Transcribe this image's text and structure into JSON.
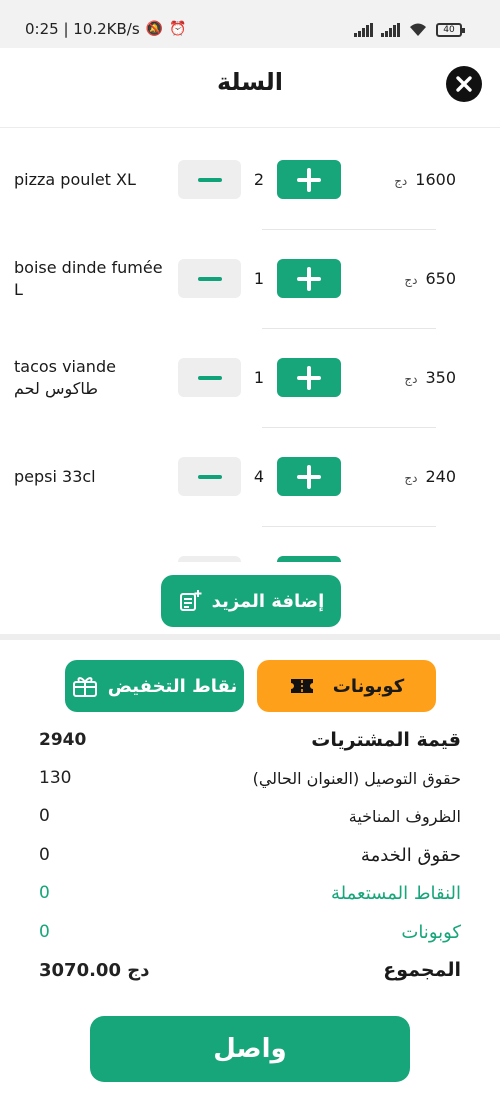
{
  "status_bar": {
    "time_speed": "0:25 | 10.2KB/s",
    "battery": "40"
  },
  "header": {
    "title": "السلة"
  },
  "cart": {
    "items": [
      {
        "name": "pizza poulet XL",
        "qty": "2",
        "price": "1600",
        "currency": "دج"
      },
      {
        "name": "boise dinde fumée L",
        "qty": "1",
        "price": "650",
        "currency": "دج"
      },
      {
        "name": "tacos viande طاكوس لحم",
        "qty": "1",
        "price": "350",
        "currency": "دج"
      },
      {
        "name": "pepsi 33cl",
        "qty": "4",
        "price": "240",
        "currency": "دج"
      }
    ],
    "add_more_label": "إضافة المزيد"
  },
  "discounts": {
    "coupons_label": "كوبونات",
    "points_label": "نقاط التخفيض"
  },
  "summary": {
    "purchases_label": "قيمة المشتريات",
    "purchases_value": "2940",
    "delivery_label": "حقوق التوصيل (العنوان الحالي)",
    "delivery_value": "130",
    "weather_label": "الظروف المناخية",
    "weather_value": "0",
    "service_label": "حقوق الخدمة",
    "service_value": "0",
    "points_used_label": "النقاط المستعملة",
    "points_used_value": "0",
    "coupons_label": "كوبونات",
    "coupons_value": "0",
    "total_label": "المجموع",
    "total_value": "3070.00 دج"
  },
  "footer": {
    "continue_label": "واصل"
  },
  "colors": {
    "accent": "#17a57a",
    "coupon": "#ffa01a"
  }
}
